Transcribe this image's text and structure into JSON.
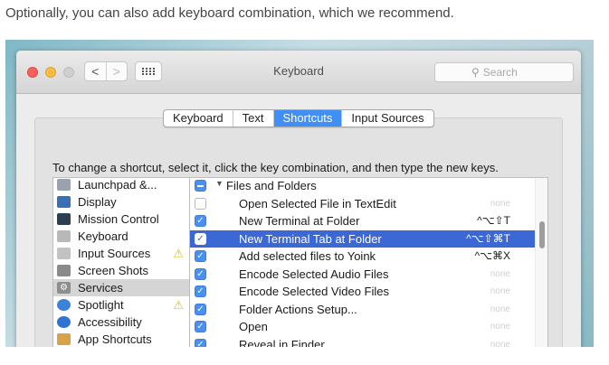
{
  "article": {
    "intro_text": "Optionally, you can also add keyboard combination, which we recommend."
  },
  "window": {
    "title": "Keyboard",
    "search_placeholder": "Search",
    "nav_back": "<",
    "nav_forward": ">"
  },
  "tabs": [
    {
      "label": "Keyboard",
      "active": false
    },
    {
      "label": "Text",
      "active": false
    },
    {
      "label": "Shortcuts",
      "active": true
    },
    {
      "label": "Input Sources",
      "active": false
    }
  ],
  "instruction": "To change a shortcut, select it, click the key combination, and then type the new keys.",
  "sidebar": {
    "items": [
      {
        "label": "Launchpad &...",
        "icon": "launchpad-icon",
        "color": "#9aa3ad",
        "warning": false
      },
      {
        "label": "Display",
        "icon": "display-icon",
        "color": "#3a6fb5",
        "warning": false
      },
      {
        "label": "Mission Control",
        "icon": "mission-control-icon",
        "color": "#2c3e50",
        "warning": false
      },
      {
        "label": "Keyboard",
        "icon": "keyboard-icon",
        "color": "#b8b8b8",
        "warning": false
      },
      {
        "label": "Input Sources",
        "icon": "input-sources-icon",
        "color": "#c2c2c2",
        "warning": true
      },
      {
        "label": "Screen Shots",
        "icon": "screenshot-icon",
        "color": "#8a8a8a",
        "warning": false
      },
      {
        "label": "Services",
        "icon": "services-gear-icon",
        "color": "#8e8e8e",
        "warning": false,
        "selected": true
      },
      {
        "label": "Spotlight",
        "icon": "spotlight-icon",
        "color": "#3b82d8",
        "warning": true
      },
      {
        "label": "Accessibility",
        "icon": "accessibility-icon",
        "color": "#2f74d0",
        "warning": false
      },
      {
        "label": "App Shortcuts",
        "icon": "app-shortcuts-icon",
        "color": "#d8a24a",
        "warning": false
      }
    ]
  },
  "list": {
    "group_label": "Files and Folders",
    "rows": [
      {
        "label": "Open Selected File in TextEdit",
        "checked": false,
        "shortcut": "none",
        "selected": false
      },
      {
        "label": "New Terminal at Folder",
        "checked": true,
        "shortcut": "^⌥⇧T",
        "selected": false
      },
      {
        "label": "New Terminal Tab at Folder",
        "checked": true,
        "shortcut": "^⌥⇧⌘T",
        "selected": true
      },
      {
        "label": "Add selected files to Yoink",
        "checked": true,
        "shortcut": "^⌥⌘X",
        "selected": false
      },
      {
        "label": "Encode Selected Audio Files",
        "checked": true,
        "shortcut": "none",
        "selected": false
      },
      {
        "label": "Encode Selected Video Files",
        "checked": true,
        "shortcut": "none",
        "selected": false
      },
      {
        "label": "Folder Actions Setup...",
        "checked": true,
        "shortcut": "none",
        "selected": false
      },
      {
        "label": "Open",
        "checked": true,
        "shortcut": "none",
        "selected": false
      },
      {
        "label": "Reveal in Finder",
        "checked": true,
        "shortcut": "none",
        "selected": false
      }
    ]
  },
  "colors": {
    "selection_blue": "#3c68d6",
    "tab_active": "#3f8ff6",
    "checkbox_blue": "#4a90f0",
    "warning_yellow": "#e7b519"
  }
}
